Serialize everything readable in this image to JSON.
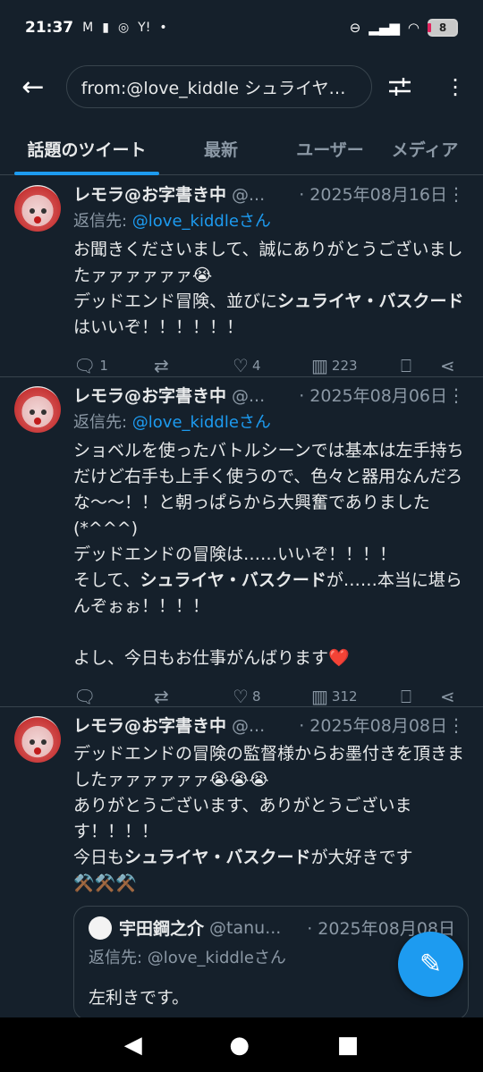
{
  "status": {
    "time": "21:37",
    "icons": [
      "gmail-icon",
      "battery-saver-icon",
      "instagram-icon",
      "yahoo-icon",
      "dot-icon"
    ],
    "app_icon_labels": [
      "M",
      "Y!"
    ],
    "battery": "8"
  },
  "search": {
    "query": "from:@love_kiddle シュライヤ…"
  },
  "tabs": [
    "話題のツイート",
    "最新",
    "ユーザー",
    "メディア"
  ],
  "tweets": [
    {
      "name": "レモラ@お字書き中",
      "handle": "@...",
      "date": "· 2025年08月16日",
      "reply_prefix": "返信先: ",
      "reply_to": "@love_kiddleさん",
      "body_parts": [
        "お聞きくださいまして、誠にありがとうございましたァァァァァァ😭\nデッドエンド冒険、並びに",
        "シュライヤ・バスクード",
        "はいいぞ！！！！！！"
      ],
      "replies": "1",
      "retweets": "",
      "likes": "4",
      "views": "223"
    },
    {
      "name": "レモラ@お字書き中",
      "handle": "@...",
      "date": "· 2025年08月06日",
      "reply_prefix": "返信先: ",
      "reply_to": "@love_kiddleさん",
      "body_parts": [
        "ショベルを使ったバトルシーンでは基本は左手持ちだけど右手も上手く使うので、色々と器用なんだろな〜〜！！と朝っぱらから大興奮でありました(*^^^)\nデッドエンドの冒険は……いいぞ！！！！\nそして、",
        "シュライヤ・バスクード",
        "が……本当に堪らんぞぉぉ！！！！\n\nよし、今日もお仕事がんばります❤️"
      ],
      "replies": "",
      "retweets": "",
      "likes": "8",
      "views": "312"
    },
    {
      "name": "レモラ@お字書き中",
      "handle": "@...",
      "date": "· 2025年08月08日",
      "body_parts": [
        "デッドエンドの冒険の監督様からお墨付きを頂きましたァァァァァァ😭😭😭\nありがとうございます、ありがとうございます！！！！\n今日も",
        "シュライヤ・バスクード",
        "が大好きです\n⚒️⚒️⚒️"
      ],
      "quote": {
        "name": "宇田鋼之介",
        "handle": "@tanu...",
        "date": "· 2025年08月08日",
        "reply_prefix": "返信先: ",
        "reply_to": "@love_kiddleさん",
        "body": "左利きです。"
      }
    }
  ],
  "colors": {
    "background": "#15202b",
    "accent": "#1d9bf0",
    "secondary_text": "#8b98a5",
    "border": "#38444d"
  }
}
